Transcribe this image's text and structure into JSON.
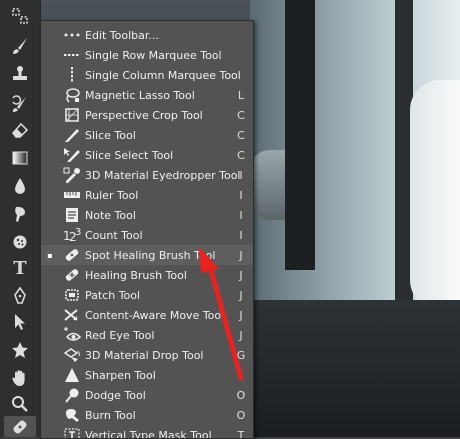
{
  "menu": {
    "items": [
      {
        "label": "Edit Toolbar...",
        "key": "",
        "icon": "more-dots-icon"
      },
      {
        "label": "Single Row Marquee Tool",
        "key": "",
        "icon": "single-row-marquee-icon"
      },
      {
        "label": "Single Column Marquee Tool",
        "key": "",
        "icon": "single-column-marquee-icon"
      },
      {
        "label": "Magnetic Lasso Tool",
        "key": "L",
        "icon": "magnetic-lasso-icon"
      },
      {
        "label": "Perspective Crop Tool",
        "key": "C",
        "icon": "perspective-crop-icon"
      },
      {
        "label": "Slice Tool",
        "key": "C",
        "icon": "slice-icon"
      },
      {
        "label": "Slice Select Tool",
        "key": "C",
        "icon": "slice-select-icon"
      },
      {
        "label": "3D Material Eyedropper Tool",
        "key": "I",
        "icon": "3d-eyedropper-icon"
      },
      {
        "label": "Ruler Tool",
        "key": "I",
        "icon": "ruler-icon"
      },
      {
        "label": "Note Tool",
        "key": "I",
        "icon": "note-icon"
      },
      {
        "label": "Count Tool",
        "key": "I",
        "icon": "count-icon"
      },
      {
        "label": "Spot Healing Brush Tool",
        "key": "J",
        "icon": "spot-healing-brush-icon",
        "selected": "▪"
      },
      {
        "label": "Healing Brush Tool",
        "key": "J",
        "icon": "healing-brush-icon"
      },
      {
        "label": "Patch Tool",
        "key": "J",
        "icon": "patch-icon"
      },
      {
        "label": "Content-Aware Move Tool",
        "key": "J",
        "icon": "content-aware-move-icon"
      },
      {
        "label": "Red Eye Tool",
        "key": "J",
        "icon": "red-eye-icon"
      },
      {
        "label": "3D Material Drop Tool",
        "key": "G",
        "icon": "3d-material-drop-icon"
      },
      {
        "label": "Sharpen Tool",
        "key": "",
        "icon": "sharpen-icon"
      },
      {
        "label": "Dodge Tool",
        "key": "O",
        "icon": "dodge-icon"
      },
      {
        "label": "Burn Tool",
        "key": "O",
        "icon": "burn-icon"
      },
      {
        "label": "Vertical Type Mask Tool",
        "key": "T",
        "icon": "vertical-type-mask-icon"
      }
    ]
  },
  "toolbar": {
    "tools": [
      "artboard-icon",
      "brush-icon",
      "stamp-icon",
      "history-brush-icon",
      "eraser-icon",
      "gradient-icon",
      "blur-drop-icon",
      "smudge-icon",
      "sponge-icon",
      "type-icon",
      "pen-icon",
      "selection-arrow-icon",
      "shape-icon",
      "hand-icon",
      "zoom-icon",
      "spot-healing-active-icon"
    ],
    "type_glyph": "T"
  },
  "colors": {
    "menu_bg": "#535353",
    "toolbar_bg": "#2f2f2f",
    "annotation_arrow": "#e8221e"
  }
}
